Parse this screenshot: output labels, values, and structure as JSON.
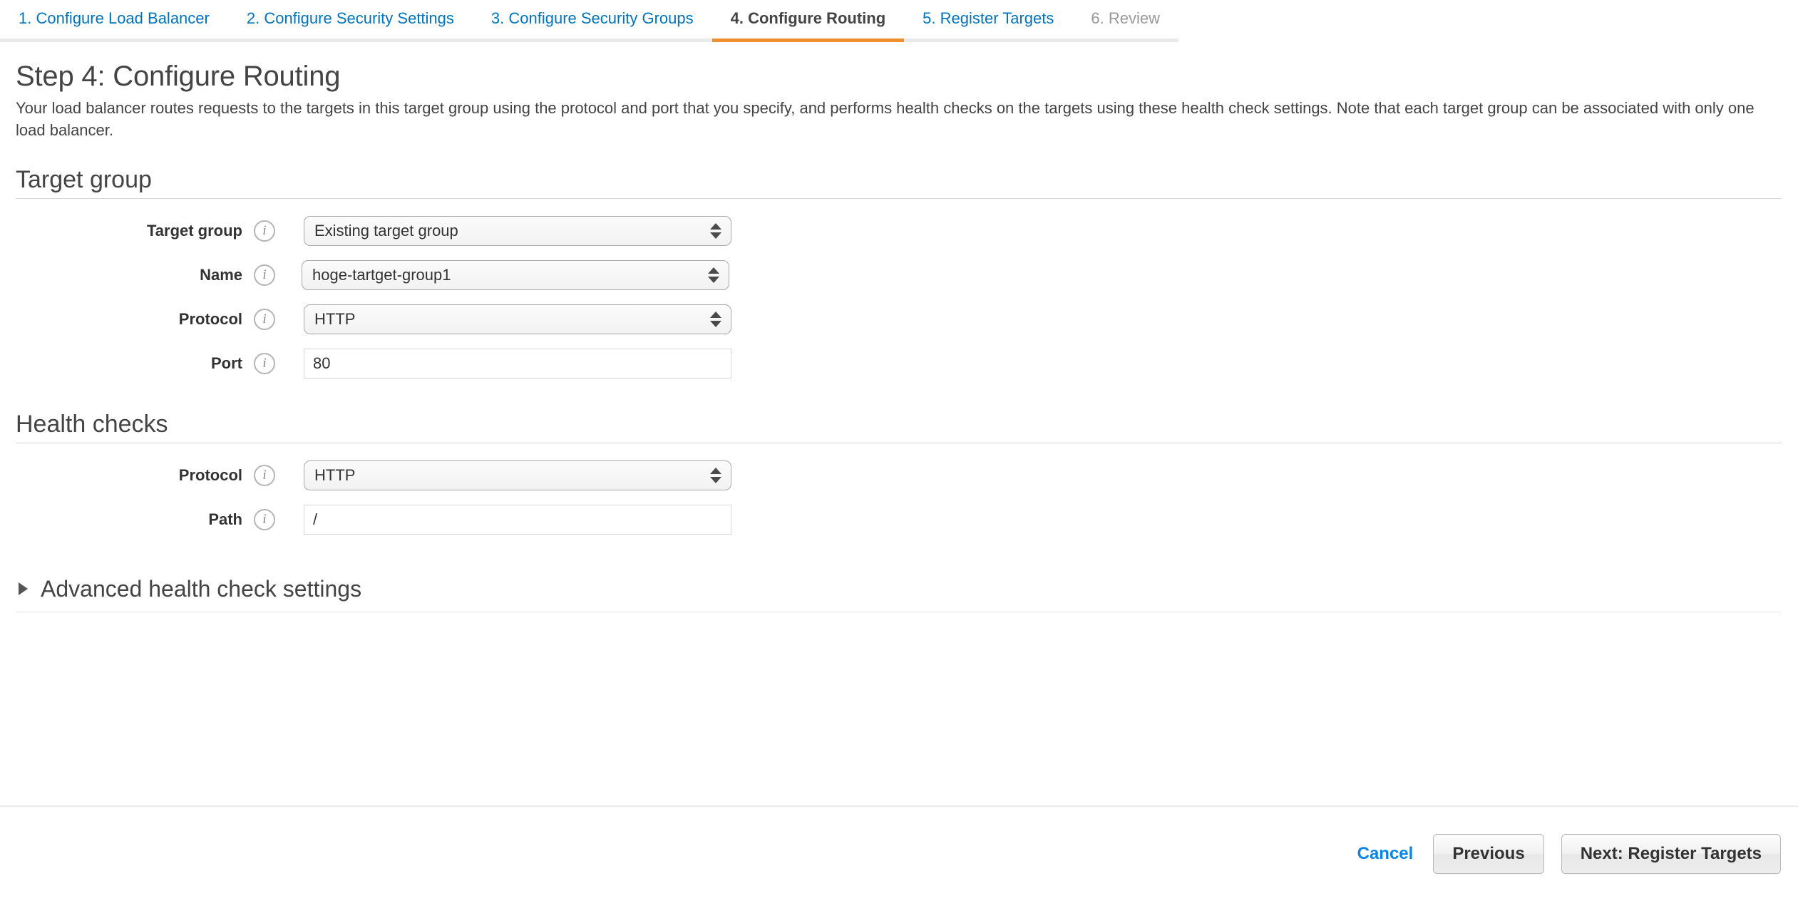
{
  "wizard": {
    "tabs": [
      {
        "label": "1. Configure Load Balancer",
        "state": "link"
      },
      {
        "label": "2. Configure Security Settings",
        "state": "link"
      },
      {
        "label": "3. Configure Security Groups",
        "state": "link"
      },
      {
        "label": "4. Configure Routing",
        "state": "active"
      },
      {
        "label": "5. Register Targets",
        "state": "link"
      },
      {
        "label": "6. Review",
        "state": "disabled"
      }
    ],
    "active_color": "#ec912d",
    "link_color": "#0073bb",
    "disabled_color": "#999999"
  },
  "page": {
    "title": "Step 4: Configure Routing",
    "description": "Your load balancer routes requests to the targets in this target group using the protocol and port that you specify, and performs health checks on the targets using these health check settings. Note that each target group can be associated with only one load balancer."
  },
  "target_group_section": {
    "title": "Target group",
    "fields": [
      {
        "label": "Target group",
        "info": "info-icon",
        "type": "select",
        "value": "Existing target group"
      },
      {
        "label": "Name",
        "info": "info-icon",
        "type": "select",
        "value": "hoge-tartget-group1"
      },
      {
        "label": "Protocol",
        "info": "info-icon",
        "type": "select",
        "value": "HTTP"
      },
      {
        "label": "Port",
        "info": "info-icon",
        "type": "text",
        "value": "80"
      }
    ]
  },
  "health_checks_section": {
    "title": "Health checks",
    "fields": [
      {
        "label": "Protocol",
        "info": "info-icon",
        "type": "select",
        "value": "HTTP"
      },
      {
        "label": "Path",
        "info": "info-icon",
        "type": "text",
        "value": "/"
      }
    ]
  },
  "advanced": {
    "label": "Advanced health check settings",
    "expanded": false,
    "triangle": "triangle-right-icon"
  },
  "footer": {
    "cancel_label": "Cancel",
    "previous_label": "Previous",
    "next_label": "Next: Register Targets",
    "cancel_color": "#0a84e8"
  }
}
